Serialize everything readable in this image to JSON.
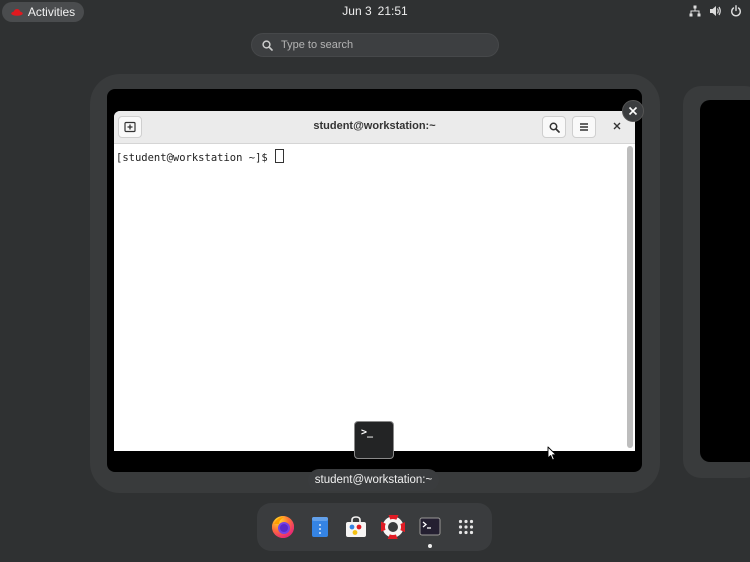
{
  "topbar": {
    "activities_label": "Activities",
    "date": "Jun 3",
    "time": "21:51",
    "icons": [
      "network-icon",
      "volume-icon",
      "power-icon"
    ]
  },
  "search": {
    "placeholder": "Type to search"
  },
  "terminal": {
    "title": "student@workstation:~",
    "prompt": "[student@workstation ~]$ ",
    "buttons": [
      "new-tab-icon",
      "search-icon",
      "menu-icon",
      "close-icon"
    ]
  },
  "window_caption": "student@workstation:~",
  "window_icon_glyph": ">_",
  "dash": {
    "apps": [
      "firefox-icon",
      "text-editor-icon",
      "software-icon",
      "help-icon",
      "terminal-icon",
      "app-grid-icon"
    ],
    "running": "terminal-icon"
  },
  "colors": {
    "background": "#2f3132",
    "workspace": "#393b3c",
    "activities_hat": "#e0191f",
    "files_blue": "#3584e4"
  }
}
